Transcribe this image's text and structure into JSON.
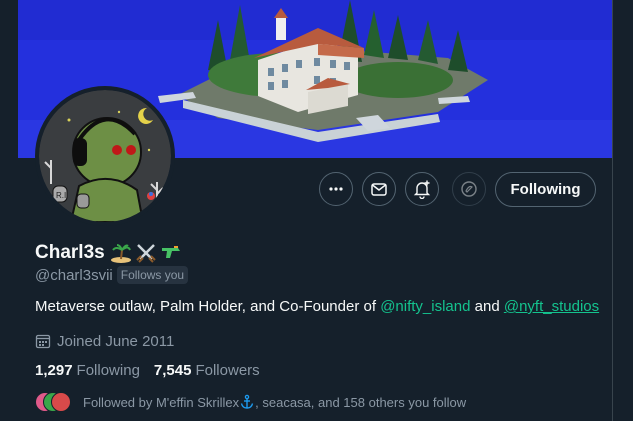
{
  "profile": {
    "display_name": "Charl3s",
    "name_emojis": [
      "island-emoji",
      "crossed-swords-emoji",
      "water-pistol-emoji"
    ],
    "handle": "@charl3svii",
    "follows_you_badge": "Follows you",
    "bio": {
      "text_before": "Metaverse outlaw, Palm Holder, and Co-Founder of ",
      "mention1": "@nifty_island",
      "text_middle": " and ",
      "mention2": "@nyft_studios"
    },
    "joined": "Joined June 2011",
    "following_count": "1,297",
    "following_label": "Following",
    "followers_count": "7,545",
    "followers_label": "Followers",
    "followed_by": {
      "prefix": "Followed by M'effin Skrillex ",
      "suffix": ", seacasa, and 158 others you follow"
    }
  },
  "actions": {
    "more_icon": "more-icon",
    "message_icon": "message-icon",
    "notify_icon": "bell-plus-icon",
    "tip_icon": "tip-icon",
    "follow_button_label": "Following"
  },
  "colors": {
    "background": "#15202b",
    "accent_blue": "#1d9bf0",
    "mention_green": "#14c38e",
    "muted_text": "#8b98a5",
    "banner_sky": "#1f2dd6"
  }
}
